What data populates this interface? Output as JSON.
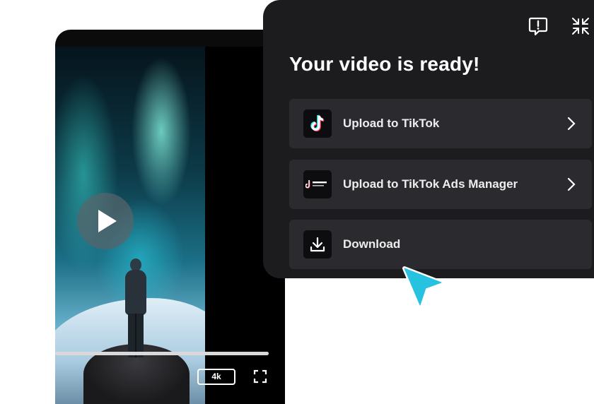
{
  "player": {
    "quality_label": "4k",
    "progress": 1.0
  },
  "panel": {
    "title": "Your video is ready!",
    "options": [
      {
        "label": "Upload to TikTok",
        "icon": "tiktok-logo-icon"
      },
      {
        "label": "Upload to TikTok Ads Manager",
        "icon": "tiktok-for-business-logo-icon",
        "logo_text": "TikTok for Business"
      },
      {
        "label": "Download",
        "icon": "download-icon"
      }
    ]
  },
  "colors": {
    "panel_bg": "#1c1c1f",
    "option_bg": "#2b2b2f",
    "cursor_accent": "#27c2e0"
  }
}
